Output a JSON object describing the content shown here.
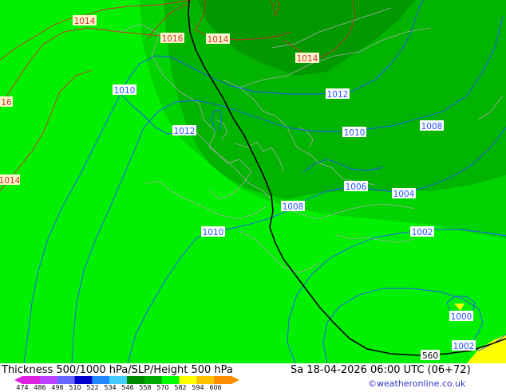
{
  "header": {
    "title": "Thickness 500/1000 hPa/SLP/Height 500 hPa",
    "valid_time": "Sa 18-04-2026 06:00 UTC (06+72)",
    "credit": "©weatheronline.co.uk"
  },
  "legend": {
    "ticks": [
      "474",
      "486",
      "498",
      "510",
      "522",
      "534",
      "546",
      "558",
      "570",
      "582",
      "594",
      "606"
    ],
    "colors": [
      "#e020e0",
      "#c040ff",
      "#6666ff",
      "#0000cc",
      "#2288ff",
      "#44ccff",
      "#008800",
      "#00aa00",
      "#00ff00",
      "#ffff00",
      "#ffc000",
      "#ff8c00"
    ]
  },
  "colors": {
    "slp_isobar": "#2255ff",
    "slp_isobar_high": "#cc3333",
    "height_contour": "#000000",
    "coastline": "#aaaaaa",
    "thickness_light": "#00f000",
    "thickness_mid": "#00d400",
    "thickness_dark": "#00b400",
    "thickness_darker": "#009900",
    "thickness_yellow": "#ffff00"
  },
  "map": {
    "isobar_labels": [
      {
        "text": "1014",
        "kind": "high"
      },
      {
        "text": "1016",
        "kind": "high"
      },
      {
        "text": "1014",
        "kind": "high"
      },
      {
        "text": "1014",
        "kind": "high"
      },
      {
        "text": "16",
        "kind": "high"
      },
      {
        "text": "1014",
        "kind": "high"
      },
      {
        "text": "1010",
        "kind": "low"
      },
      {
        "text": "1012",
        "kind": "low"
      },
      {
        "text": "1012",
        "kind": "low"
      },
      {
        "text": "1010",
        "kind": "low"
      },
      {
        "text": "1008",
        "kind": "low"
      },
      {
        "text": "1006",
        "kind": "low"
      },
      {
        "text": "1004",
        "kind": "low"
      },
      {
        "text": "1008",
        "kind": "low"
      },
      {
        "text": "1010",
        "kind": "low"
      },
      {
        "text": "1002",
        "kind": "low"
      },
      {
        "text": "1000",
        "kind": "low"
      },
      {
        "text": "1002",
        "kind": "low"
      }
    ],
    "height_label": "560"
  }
}
